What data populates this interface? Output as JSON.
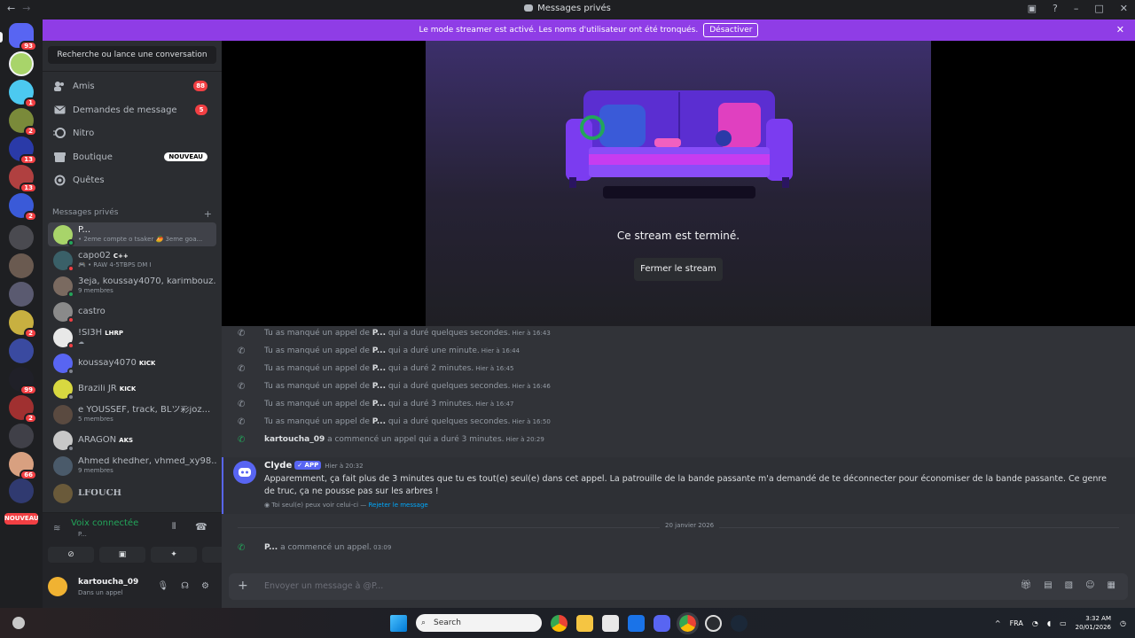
{
  "titlebar": {
    "title": "Messages privés",
    "back": "←",
    "forward": "→"
  },
  "banner": {
    "text": "Le mode streamer est activé. Les noms d'utilisateur ont été tronqués.",
    "button": "Désactiver"
  },
  "rail": {
    "badges": [
      "93",
      "1",
      "2",
      "13",
      "13",
      "2",
      "2",
      "99",
      "2",
      "66"
    ],
    "new_label": "NOUVEAU"
  },
  "sidebar": {
    "search": "Recherche ou lance une conversation",
    "nav": [
      {
        "label": "Amis",
        "count": "88"
      },
      {
        "label": "Demandes de message",
        "count": "5"
      },
      {
        "label": "Nitro"
      },
      {
        "label": "Boutique",
        "badge": "NOUVEAU"
      },
      {
        "label": "Quêtes"
      }
    ],
    "dm_header": "Messages privés",
    "dm_add": "+",
    "dms": [
      {
        "name": "P...",
        "sub": "• 2eme compte o tsaker 🥭 3eme goa..."
      },
      {
        "name": "capo02",
        "tag": "C++",
        "sub": "🎮 • RAW 4-5TBPS DM I"
      },
      {
        "name": "3eja, koussay4070, karimbouz...",
        "sub": "9 membres"
      },
      {
        "name": "castro",
        "sub": ""
      },
      {
        "name": "!SI3H",
        "tag": "LHRP",
        "sub": "☁"
      },
      {
        "name": "koussay4070",
        "tag": "KICK",
        "sub": ""
      },
      {
        "name": "Brazili JR",
        "tag": "KICK",
        "sub": ""
      },
      {
        "name": "e YOUSSEF, track, BLツ彩joz...",
        "sub": "5 membres"
      },
      {
        "name": "ARAGON",
        "tag": "AKS",
        "sub": ""
      },
      {
        "name": "Ahmed khedher, vhmed_xy98...",
        "sub": "9 membres"
      },
      {
        "name": "LFOUCH",
        "sub": ""
      }
    ]
  },
  "voice": {
    "status": "Voix connectée",
    "channel": "P..."
  },
  "user": {
    "name": "kartoucha_09",
    "status": "Dans un appel"
  },
  "stream": {
    "ended": "Ce stream est terminé.",
    "close": "Fermer le stream"
  },
  "calls": [
    {
      "pre": "Tu as manqué un appel de ",
      "who": "P...",
      "post": " qui a duré quelques secondes.",
      "time": "Hier à 16:43"
    },
    {
      "pre": "Tu as manqué un appel de ",
      "who": "P...",
      "post": " qui a duré une minute.",
      "time": "Hier à 16:44"
    },
    {
      "pre": "Tu as manqué un appel de ",
      "who": "P...",
      "post": " qui a duré 2 minutes.",
      "time": "Hier à 16:45"
    },
    {
      "pre": "Tu as manqué un appel de ",
      "who": "P...",
      "post": " qui a duré quelques secondes.",
      "time": "Hier à 16:46"
    },
    {
      "pre": "Tu as manqué un appel de ",
      "who": "P...",
      "post": " qui a duré 3 minutes.",
      "time": "Hier à 16:47"
    },
    {
      "pre": "Tu as manqué un appel de ",
      "who": "P...",
      "post": " qui a duré quelques secondes.",
      "time": "Hier à 16:50"
    },
    {
      "pre": "",
      "who": "kartoucha_09",
      "post": " a commencé un appel qui a duré 3 minutes.",
      "time": "Hier à 20:29"
    }
  ],
  "clyde": {
    "author": "Clyde",
    "app": "APP",
    "time": "Hier à 20:32",
    "body": "Apparemment, ça fait plus de 3 minutes que tu es tout(e) seul(e) dans cet appel. La patrouille de la bande passante m'a demandé de te déconnecter pour économiser de la bande passante. Ce genre de truc, ça ne pousse pas sur les arbres !",
    "ephemeral": "Toi seul(e) peux voir celui-ci — ",
    "dismiss": "Rejeter le message"
  },
  "date_divider": "20 janvier 2026",
  "last_call": {
    "who": "P...",
    "post": " a commencé un appel.",
    "time": "03:09"
  },
  "composer": {
    "placeholder": "Envoyer un message à @P..."
  },
  "taskbar": {
    "search": "Search",
    "lang": "FRA",
    "time": "3:32 AM",
    "date": "20/01/2026"
  },
  "colors": {
    "accent": "#5865f2",
    "banner": "#8f3de6",
    "danger": "#f23f43",
    "online": "#23a55a"
  }
}
